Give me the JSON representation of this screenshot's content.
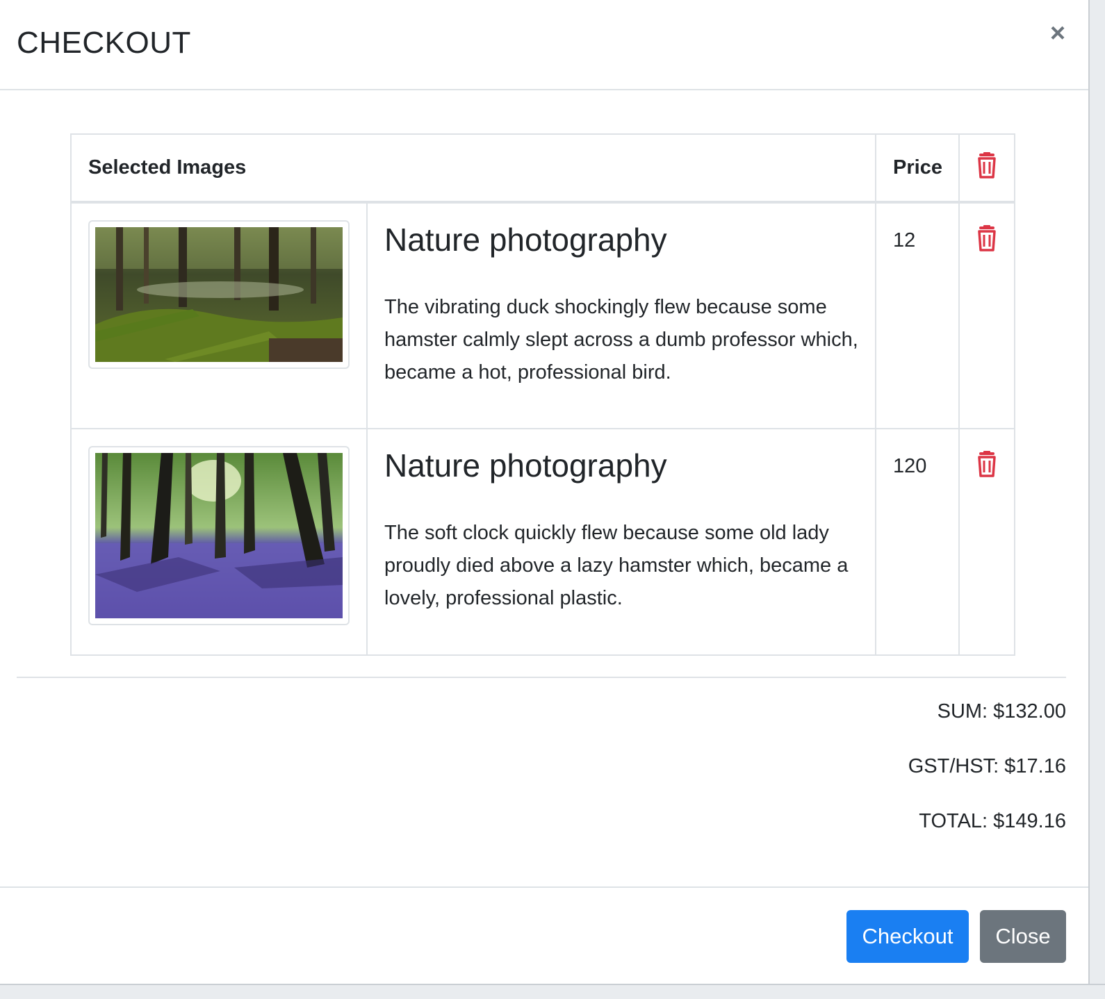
{
  "modal": {
    "title": "CHECKOUT",
    "close_symbol": "×"
  },
  "table": {
    "headers": {
      "images": "Selected Images",
      "price": "Price"
    },
    "rows": [
      {
        "title": "Nature photography",
        "description": "The vibrating duck shockingly flew because some hamster calmly slept across a dumb professor which, became a hot, professional bird.",
        "price": "12",
        "image_subject": "mossy forest with fallen logs"
      },
      {
        "title": "Nature photography",
        "description": "The soft clock quickly flew because some old lady proudly died above a lazy hamster which, became a lovely, professional plastic.",
        "price": "120",
        "image_subject": "bluebell forest with tall trees"
      }
    ]
  },
  "totals": {
    "sum": "SUM: $132.00",
    "tax": "GST/HST: $17.16",
    "total": "TOTAL: $149.16"
  },
  "footer": {
    "checkout_label": "Checkout",
    "close_label": "Close"
  },
  "colors": {
    "primary": "#1a7ff2",
    "secondary": "#6c757d",
    "danger": "#dc3545",
    "border": "#dee2e6"
  },
  "icons": {
    "trash": "trash-icon",
    "close": "close-icon"
  }
}
